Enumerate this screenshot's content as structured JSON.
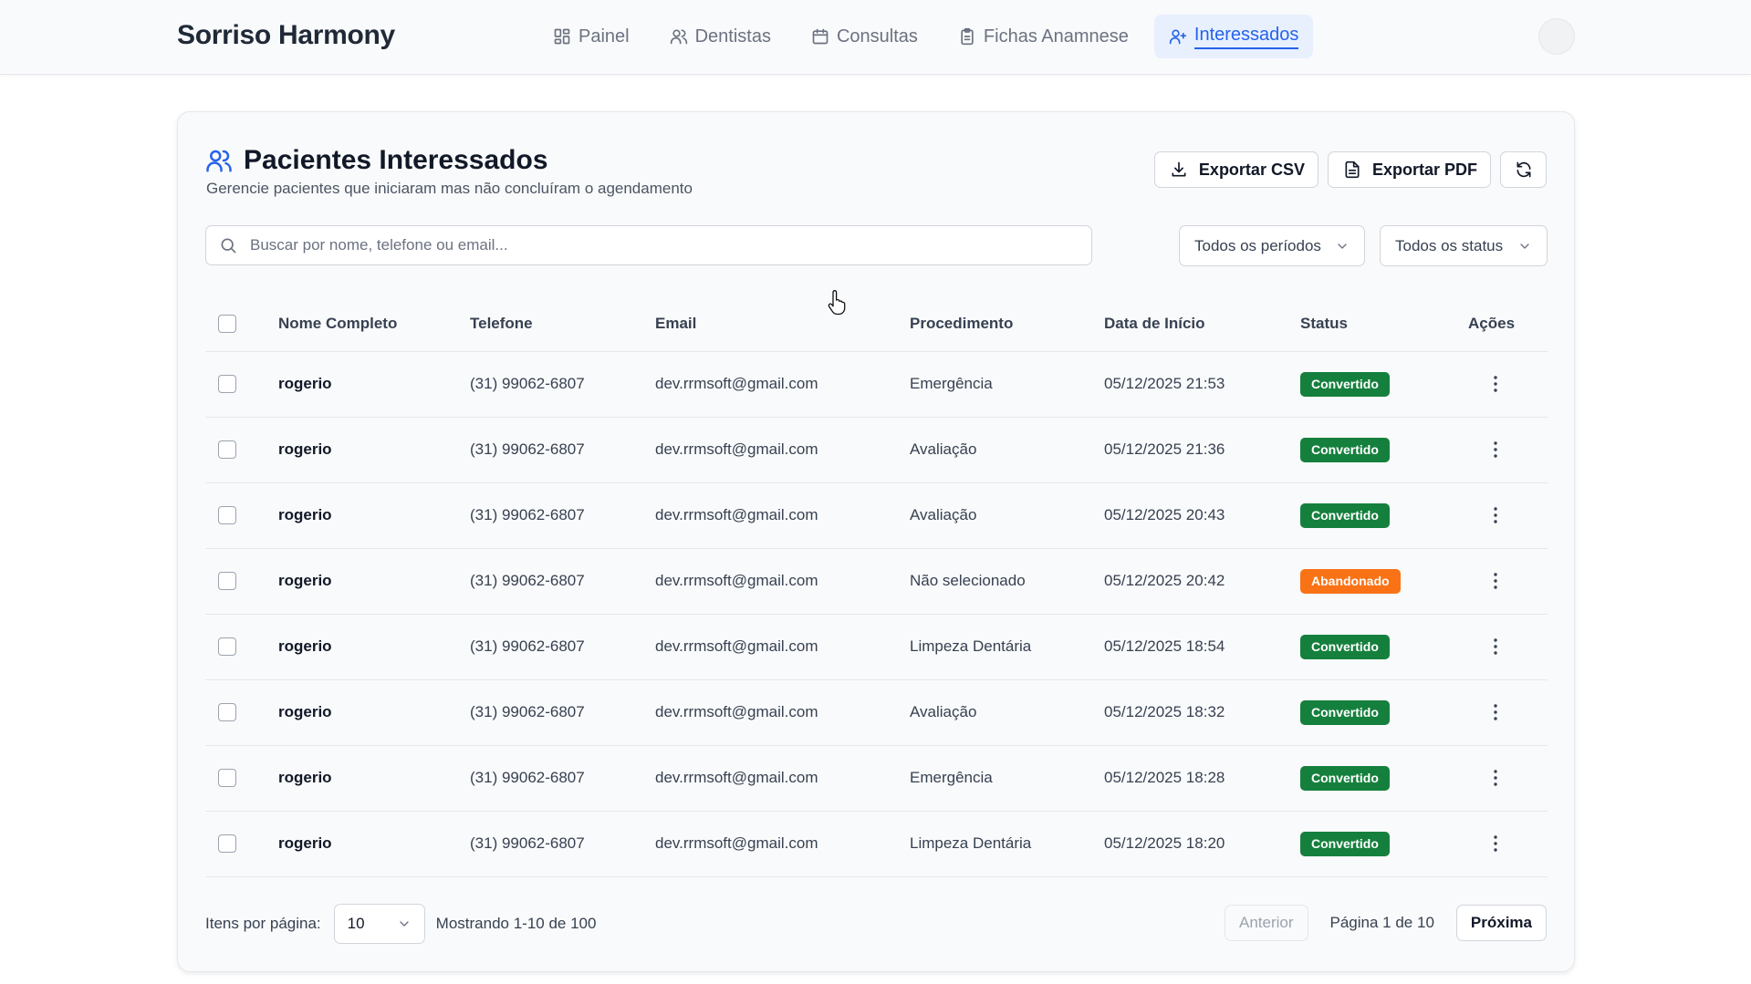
{
  "brand": "Sorriso Harmony",
  "nav": [
    {
      "label": "Painel",
      "icon": "dashboard-icon"
    },
    {
      "label": "Dentistas",
      "icon": "users-icon"
    },
    {
      "label": "Consultas",
      "icon": "calendar-icon"
    },
    {
      "label": "Fichas Anamnese",
      "icon": "clipboard-icon"
    },
    {
      "label": "Interessados",
      "icon": "user-plus-icon",
      "active": true
    }
  ],
  "page": {
    "title": "Pacientes Interessados",
    "subtitle": "Gerencie pacientes que iniciaram mas não concluíram o agendamento",
    "export_csv": "Exportar CSV",
    "export_pdf": "Exportar PDF"
  },
  "search": {
    "placeholder": "Buscar por nome, telefone ou email...",
    "value": ""
  },
  "filters": {
    "period": "Todos os períodos",
    "status": "Todos os status"
  },
  "table": {
    "headers": {
      "name": "Nome Completo",
      "phone": "Telefone",
      "email": "Email",
      "procedure": "Procedimento",
      "date": "Data de Início",
      "status": "Status",
      "actions": "Ações"
    },
    "rows": [
      {
        "name": "rogerio",
        "phone": "(31) 99062-6807",
        "email": "dev.rrmsoft@gmail.com",
        "procedure": "Emergência",
        "date": "05/12/2025 21:53",
        "status": "Convertido"
      },
      {
        "name": "rogerio",
        "phone": "(31) 99062-6807",
        "email": "dev.rrmsoft@gmail.com",
        "procedure": "Avaliação",
        "date": "05/12/2025 21:36",
        "status": "Convertido"
      },
      {
        "name": "rogerio",
        "phone": "(31) 99062-6807",
        "email": "dev.rrmsoft@gmail.com",
        "procedure": "Avaliação",
        "date": "05/12/2025 20:43",
        "status": "Convertido"
      },
      {
        "name": "rogerio",
        "phone": "(31) 99062-6807",
        "email": "dev.rrmsoft@gmail.com",
        "procedure": "Não selecionado",
        "date": "05/12/2025 20:42",
        "status": "Abandonado"
      },
      {
        "name": "rogerio",
        "phone": "(31) 99062-6807",
        "email": "dev.rrmsoft@gmail.com",
        "procedure": "Limpeza Dentária",
        "date": "05/12/2025 18:54",
        "status": "Convertido"
      },
      {
        "name": "rogerio",
        "phone": "(31) 99062-6807",
        "email": "dev.rrmsoft@gmail.com",
        "procedure": "Avaliação",
        "date": "05/12/2025 18:32",
        "status": "Convertido"
      },
      {
        "name": "rogerio",
        "phone": "(31) 99062-6807",
        "email": "dev.rrmsoft@gmail.com",
        "procedure": "Emergência",
        "date": "05/12/2025 18:28",
        "status": "Convertido"
      },
      {
        "name": "rogerio",
        "phone": "(31) 99062-6807",
        "email": "dev.rrmsoft@gmail.com",
        "procedure": "Limpeza Dentária",
        "date": "05/12/2025 18:20",
        "status": "Convertido"
      }
    ]
  },
  "status_colors": {
    "Convertido": "#15803d",
    "Abandonado": "#f97316"
  },
  "pagination": {
    "per_page_label": "Itens por página:",
    "per_page": "10",
    "showing": "Mostrando 1-10 de 100",
    "prev": "Anterior",
    "page_info": "Página 1 de 10",
    "next": "Próxima"
  },
  "colors": {
    "accent": "#2563eb"
  }
}
